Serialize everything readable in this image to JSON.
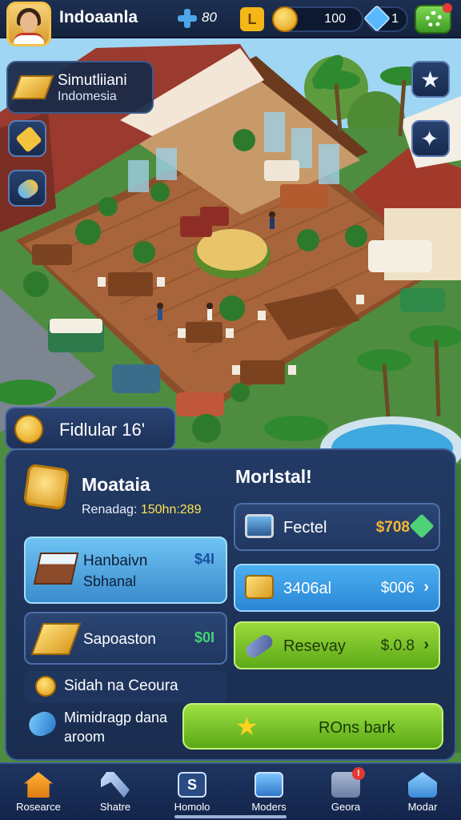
{
  "header": {
    "app_title": "Indoaanla",
    "resource_a": "80",
    "level_glyph": "L",
    "coins": "100",
    "gems": "1"
  },
  "side": {
    "card_title": "Simutliiani",
    "card_subtitle": "Indomesia"
  },
  "panel": {
    "tab_label": "Fidlular 16'",
    "profile_name": "Moataia",
    "profile_sub_label": "Renadag:",
    "profile_sub_value": "150hn:289",
    "options": [
      {
        "title": "Hanbaivn",
        "subtitle": "Sbhanal",
        "price": "$4I"
      },
      {
        "title": "Sapoaston",
        "subtitle": "",
        "price": "$0I"
      }
    ],
    "row_1": "Sidah na Ceoura",
    "row_2_line_1": "Mimidragp dana",
    "row_2_line_2": "aroom",
    "shop_title": "Morlstal!",
    "shop": [
      {
        "label": "Fectel",
        "price": "$708",
        "arrow": ""
      },
      {
        "label": "3406al",
        "price": "$006",
        "arrow": "›"
      },
      {
        "label": "Resevay",
        "price": "$.0.8",
        "arrow": "›"
      }
    ],
    "big_button": "ROns bark"
  },
  "nav": [
    {
      "label": "Rosearce",
      "icon": "home-icon"
    },
    {
      "label": "Shatre",
      "icon": "tools-icon"
    },
    {
      "label": "Homolo",
      "icon": "chat-icon"
    },
    {
      "label": "Moders",
      "icon": "monitor-icon"
    },
    {
      "label": "Geora",
      "icon": "mail-icon",
      "badge": "!"
    },
    {
      "label": "Modar",
      "icon": "navigation-icon"
    }
  ]
}
